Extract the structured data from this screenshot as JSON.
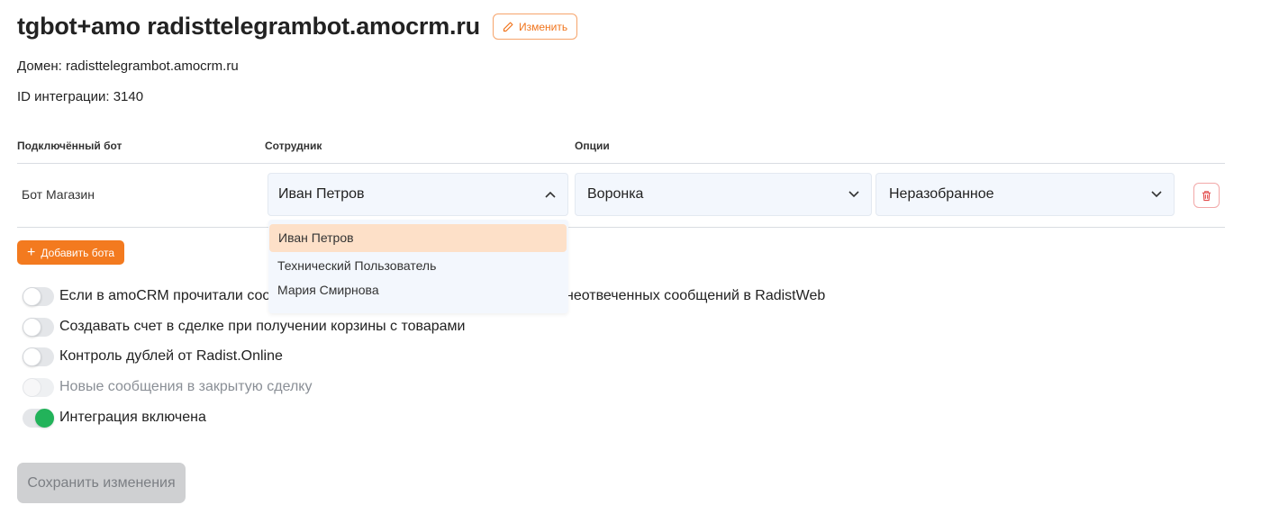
{
  "header": {
    "title": "tgbot+amo radisttelegrambot.amocrm.ru",
    "edit_label": "Изменить"
  },
  "info": {
    "domain": "Домен: radisttelegrambot.amocrm.ru",
    "integration_id": "ID интеграции: 3140"
  },
  "table": {
    "headers": {
      "bot": "Подключённый бот",
      "employee": "Сотрудник",
      "options": "Опции"
    },
    "row": {
      "bot": "Бот Магазин",
      "employee_selected": "Иван Петров",
      "pipeline": "Воронка",
      "status": "Неразобранное"
    },
    "employee_options": [
      "Иван Петров",
      "Технический Пользователь",
      "Мария Смирнова"
    ]
  },
  "add_bot_label": "Добавить бота",
  "toggles": [
    {
      "label": "Если в amoCRM прочитали сооб",
      "state": "off"
    },
    {
      "label": "Создавать счет в сделке при получении корзины с товарами",
      "state": "off"
    },
    {
      "label": "Контроль дублей от Radist.Online",
      "state": "off"
    },
    {
      "label": "Новые сообщения в закрытую сделку",
      "state": "disabled"
    },
    {
      "label": "Интеграция включена",
      "state": "on"
    }
  ],
  "toggle_label_tail": "неотвеченных сообщений в RadistWeb",
  "save_label": "Сохранить изменения",
  "colors": {
    "accent": "#f37a1f",
    "toggle_on": "#22b35a",
    "delete": "#e24c4c",
    "dropdown_selected": "#fde0c8"
  }
}
